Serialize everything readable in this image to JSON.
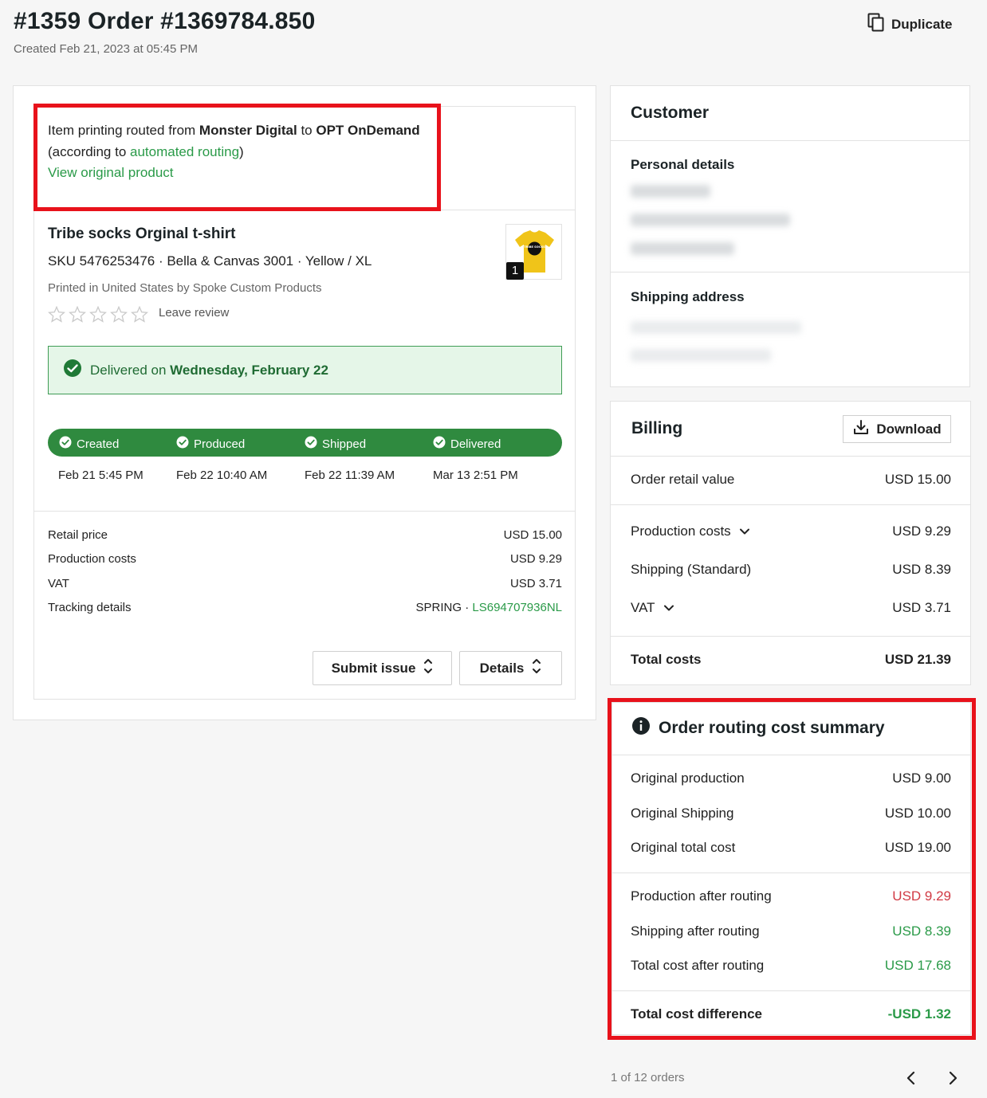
{
  "header": {
    "title": "#1359 Order #1369784.850",
    "created": "Created Feb 21, 2023 at 05:45 PM",
    "duplicate_label": "Duplicate"
  },
  "routing_notice": {
    "prefix": "Item printing routed from ",
    "from": "Monster Digital",
    "middle": " to ",
    "to": "OPT OnDemand",
    "line2_prefix": "(according to ",
    "line2_link": "automated routing",
    "line2_suffix": ")",
    "view_original": "View original product"
  },
  "product": {
    "title": "Tribe socks Orginal t-shirt",
    "sku_line": "SKU 5476253476 · Bella & Canvas 3001 · Yellow / XL",
    "printed_line": "Printed in United States by Spoke Custom  Products",
    "leave_review": "Leave review",
    "quantity": "1",
    "thumb_text": "TRIBE SOCKS"
  },
  "delivery": {
    "prefix": "Delivered on ",
    "date": "Wednesday, February 22"
  },
  "progress": {
    "steps": [
      {
        "label": "Created",
        "date": "Feb 21 5:45 PM"
      },
      {
        "label": "Produced",
        "date": "Feb 22 10:40 AM"
      },
      {
        "label": "Shipped",
        "date": "Feb 22 11:39 AM"
      },
      {
        "label": "Delivered",
        "date": "Mar 13 2:51 PM"
      }
    ]
  },
  "pricing": {
    "retail_label": "Retail price",
    "retail_value": "USD 15.00",
    "production_label": "Production costs",
    "production_value": "USD 9.29",
    "vat_label": "VAT",
    "vat_value": "USD 3.71",
    "tracking_label": "Tracking details",
    "tracking_carrier": "SPRING · ",
    "tracking_number": "LS694707936NL"
  },
  "actions": {
    "submit_issue": "Submit issue",
    "details": "Details"
  },
  "customer": {
    "title": "Customer",
    "personal_details": "Personal details",
    "shipping_address": "Shipping address"
  },
  "billing": {
    "title": "Billing",
    "download": "Download",
    "retail_label": "Order retail value",
    "retail_value": "USD 15.00",
    "production_label": "Production costs",
    "production_value": "USD 9.29",
    "shipping_label": "Shipping (Standard)",
    "shipping_value": "USD 8.39",
    "vat_label": "VAT",
    "vat_value": "USD 3.71",
    "total_label": "Total costs",
    "total_value": "USD 21.39"
  },
  "routing_summary": {
    "title": "Order routing cost summary",
    "orig_prod_label": "Original production",
    "orig_prod_value": "USD 9.00",
    "orig_ship_label": "Original Shipping",
    "orig_ship_value": "USD 10.00",
    "orig_total_label": "Original total cost",
    "orig_total_value": "USD 19.00",
    "prod_after_label": "Production after routing",
    "prod_after_value": "USD 9.29",
    "ship_after_label": "Shipping after routing",
    "ship_after_value": "USD 8.39",
    "total_after_label": "Total cost after routing",
    "total_after_value": "USD 17.68",
    "diff_label": "Total cost difference",
    "diff_value": "-USD 1.32"
  },
  "pager": {
    "text": "1 of 12 orders"
  },
  "colors": {
    "accent_green": "#2a9a48",
    "progress_green": "#2f8a3f",
    "alert_red": "#d13a44",
    "highlight_red": "#e8121b"
  }
}
